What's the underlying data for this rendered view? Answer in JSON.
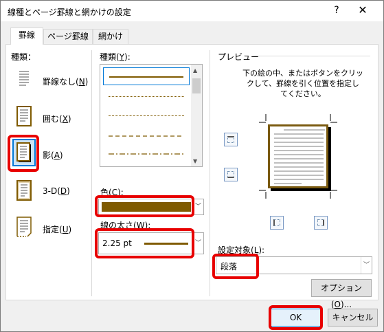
{
  "window": {
    "title": "線種とページ罫線と網かけの設定",
    "help_label": "?",
    "close_label": "✕"
  },
  "tabs": [
    {
      "label": "罫線",
      "active": true
    },
    {
      "label": "ページ罫線",
      "active": false
    },
    {
      "label": "網かけ",
      "active": false
    }
  ],
  "setting": {
    "heading": "種類：",
    "items": [
      {
        "label": "罫線なし(",
        "key": "N",
        "suffix": ")",
        "icon": "no-border-icon"
      },
      {
        "label": "囲む(",
        "key": "X",
        "suffix": ")",
        "icon": "box-border-icon"
      },
      {
        "label": "影(",
        "key": "A",
        "suffix": ")",
        "icon": "shadow-border-icon",
        "selected": true
      },
      {
        "label": "3-D(",
        "key": "D",
        "suffix": ")",
        "icon": "3d-border-icon"
      },
      {
        "label": "指定(",
        "key": "U",
        "suffix": ")",
        "icon": "custom-border-icon"
      }
    ]
  },
  "style": {
    "heading_prefix": "種類(",
    "heading_key": "Y",
    "heading_suffix": "):",
    "lines": [
      "solid",
      "dotted",
      "dashed-fine",
      "dashed",
      "dash-dot"
    ]
  },
  "color": {
    "label_prefix": "色(",
    "label_key": "C",
    "label_suffix": "):",
    "value_hex": "#7f5a00"
  },
  "width": {
    "label_prefix": "線の太さ(",
    "label_key": "W",
    "label_suffix": "):",
    "value": "2.25 pt"
  },
  "preview": {
    "heading": "プレビュー",
    "instructions_line1": "下の絵の中、またはボタンをクリッ",
    "instructions_line2": "クして、罫線を引く位置を指定し",
    "instructions_line3": "てください。"
  },
  "apply_to": {
    "label_prefix": "設定対象(",
    "label_key": "L",
    "label_suffix": "):",
    "value": "段落"
  },
  "buttons": {
    "options_prefix": "オプション(",
    "options_key": "O",
    "options_suffix": ")...",
    "ok": "OK",
    "cancel": "キャンセル"
  },
  "colors": {
    "border_brown": "#7f5a00",
    "highlight_red": "#e80000",
    "selected_blue": "#0078d7"
  }
}
